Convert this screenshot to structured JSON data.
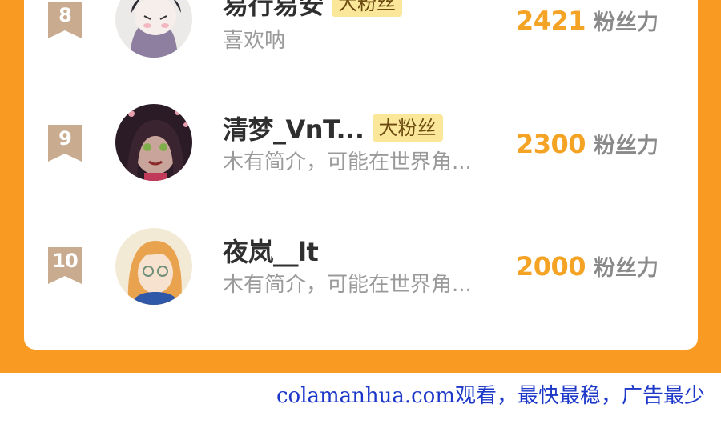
{
  "rows": [
    {
      "rank": "8",
      "name": "易行易安",
      "badge": "大粉丝",
      "bio": "喜欢呐",
      "score": "2421",
      "unit": "粉丝力"
    },
    {
      "rank": "9",
      "name": "清梦_VnT...",
      "badge": "大粉丝",
      "bio": "木有简介，可能在世界角...",
      "score": "2300",
      "unit": "粉丝力"
    },
    {
      "rank": "10",
      "name": "夜岚__lt",
      "badge": "",
      "bio": "木有简介，可能在世界角...",
      "score": "2000",
      "unit": "粉丝力"
    }
  ],
  "colors": {
    "page_background": "#f99a22",
    "rank_badge": "#c9ab8f",
    "fan_badge": "#fbe79a",
    "score": "#f5a324",
    "watermark": "#1d38c9"
  },
  "icons": [
    "rank-ribbon-icon",
    "user-avatar-icon"
  ],
  "watermark": "colamanhua.com观看，最快最稳，广告最少"
}
